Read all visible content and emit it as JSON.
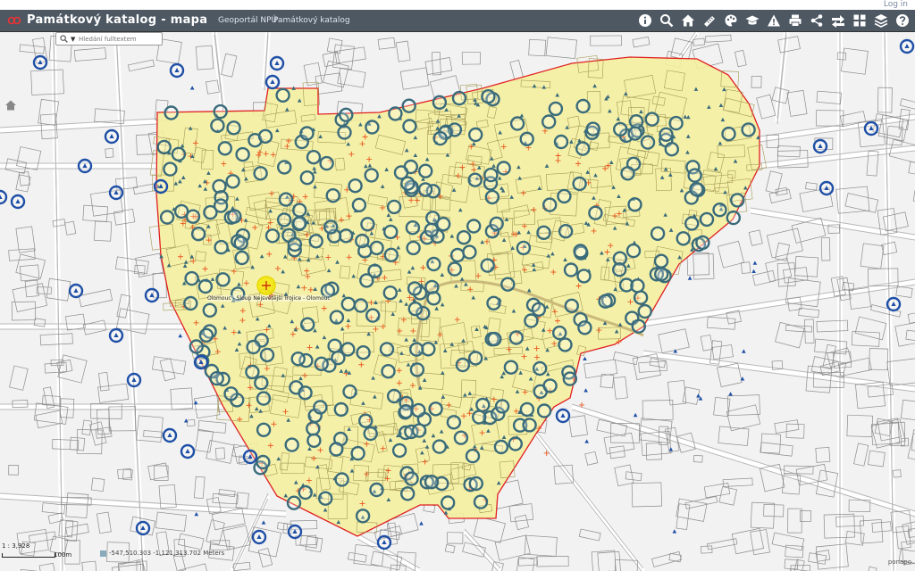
{
  "header": {
    "title": "Památkový katalog - mapa",
    "links": [
      "Geoportál NPÚ",
      "Památkový katalog"
    ],
    "login": "Log in",
    "bg_color": "#4d5863",
    "tools": [
      "info-icon",
      "search-icon",
      "home-icon",
      "measure-icon",
      "palette-icon",
      "layers-cap-icon",
      "warning-icon",
      "print-icon",
      "share-icon",
      "swap-icon",
      "grid-icon",
      "stack-icon",
      "help-icon"
    ]
  },
  "search": {
    "placeholder": "Hledání fulltextem"
  },
  "map": {
    "zone_fill": "#f5f0a0",
    "zone_border": "#e02020",
    "monument_color": "#3a6b7a",
    "outside_color": "#1e4fa6",
    "cross_color": "#e85a20",
    "highlight_color": "#f2e600",
    "popup_label": "Olomouc - Sloup Nejsvětější Trojice - Olomouc"
  },
  "status": {
    "scale": "1 : 3,928",
    "scale_bar_label": "100m",
    "coords": "-547,510.303 -1,121,313.702 Meters",
    "attribution": "ponapo"
  }
}
